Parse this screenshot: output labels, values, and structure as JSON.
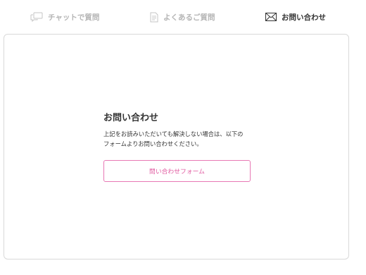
{
  "tabs": [
    {
      "label": "チャットで質問",
      "icon": "chat-bubbles-icon",
      "active": false
    },
    {
      "label": "よくあるご質問",
      "icon": "document-icon",
      "active": false
    },
    {
      "label": "お問い合わせ",
      "icon": "envelope-icon",
      "active": true
    }
  ],
  "contact": {
    "title": "お問い合わせ",
    "description_line1": "上記をお読みいただいても解決しない場合は、以下の",
    "description_line2": "フォームよりお問い合わせください。",
    "button_label": "問い合わせフォーム"
  },
  "colors": {
    "accent": "#e0589f",
    "inactive_text": "#b5b5b5",
    "active_text": "#333333",
    "panel_border": "#d9d9d9"
  }
}
